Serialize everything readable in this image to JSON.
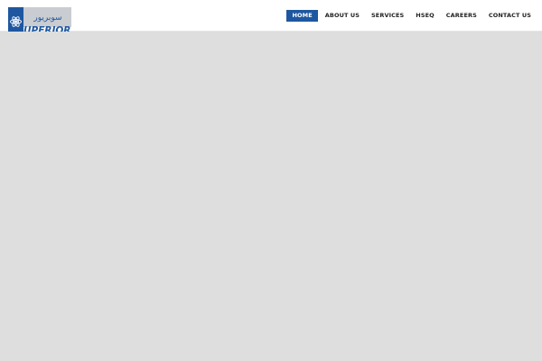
{
  "brand": {
    "logo_latin": "UPERIOR",
    "logo_arabic": "سوبريور",
    "blue": "#1e57a0",
    "gray": "#c9ccd1"
  },
  "nav": {
    "items": [
      {
        "label": "HOME",
        "active": true
      },
      {
        "label": "ABOUT US",
        "active": false
      },
      {
        "label": "SERVICES",
        "active": false
      },
      {
        "label": "HSEQ",
        "active": false
      },
      {
        "label": "CAREERS",
        "active": false
      },
      {
        "label": "CONTACT US",
        "active": false
      }
    ],
    "active_color": "#1e57a0"
  },
  "hero": {
    "background": "#dedede"
  }
}
